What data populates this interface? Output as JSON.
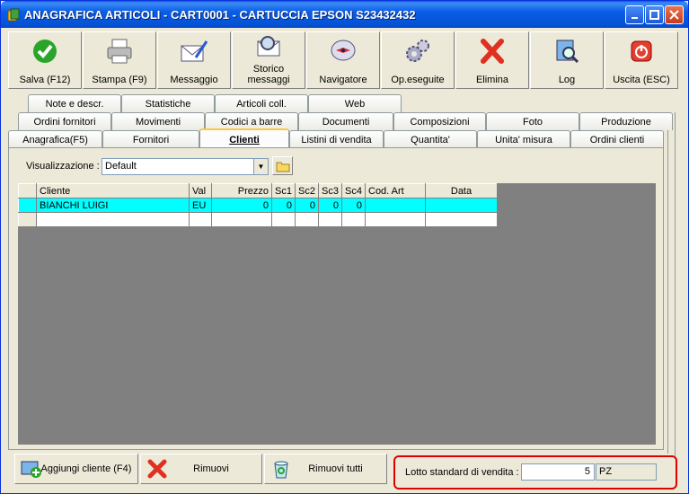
{
  "window": {
    "title": "ANAGRAFICA ARTICOLI - CART0001 - CARTUCCIA EPSON S23432432"
  },
  "toolbar": [
    {
      "label": "Salva (F12)",
      "icon": "check-icon"
    },
    {
      "label": "Stampa (F9)",
      "icon": "printer-icon"
    },
    {
      "label": "Messaggio",
      "icon": "envelope-pen-icon"
    },
    {
      "label1": "Storico",
      "label2": "messaggi",
      "icon": "search-envelope-icon"
    },
    {
      "label": "Navigatore",
      "icon": "compass-icon"
    },
    {
      "label": "Op.eseguite",
      "icon": "gears-icon"
    },
    {
      "label": "Elimina",
      "icon": "delete-x-icon"
    },
    {
      "label": "Log",
      "icon": "log-search-icon"
    },
    {
      "label": "Uscita (ESC)",
      "icon": "exit-power-icon"
    }
  ],
  "tabs": {
    "row1": [
      "Note e descr.",
      "Statistiche",
      "Articoli coll.",
      "Web"
    ],
    "row2": [
      "Ordini fornitori",
      "Movimenti",
      "Codici a barre",
      "Documenti",
      "Composizioni",
      "Foto",
      "Produzione"
    ],
    "row3": [
      "Anagrafica(F5)",
      "Fornitori",
      "Clienti",
      "Listini di vendita",
      "Quantita'",
      "Unita' misura",
      "Ordini clienti"
    ],
    "active": "Clienti"
  },
  "visualizzazione": {
    "label": "Visualizzazione :",
    "value": "Default"
  },
  "grid": {
    "columns": [
      "Cliente",
      "Val",
      "Prezzo",
      "Sc1",
      "Sc2",
      "Sc3",
      "Sc4",
      "Cod. Art",
      "Data"
    ],
    "rows": [
      [
        "BIANCHI LUIGI",
        "EU",
        "0",
        "0",
        "0",
        "0",
        "0",
        "",
        ""
      ]
    ]
  },
  "buttons": {
    "add": "Aggiungi cliente (F4)",
    "remove": "Rimuovi",
    "remove_all": "Rimuovi tutti"
  },
  "lotto": {
    "label": "Lotto standard di vendita :",
    "value": "5",
    "unit": "PZ"
  },
  "colors": {
    "selected_row": "#00ffff",
    "titlebar": "#0a5ce8",
    "highlight_box": "#e00000"
  }
}
